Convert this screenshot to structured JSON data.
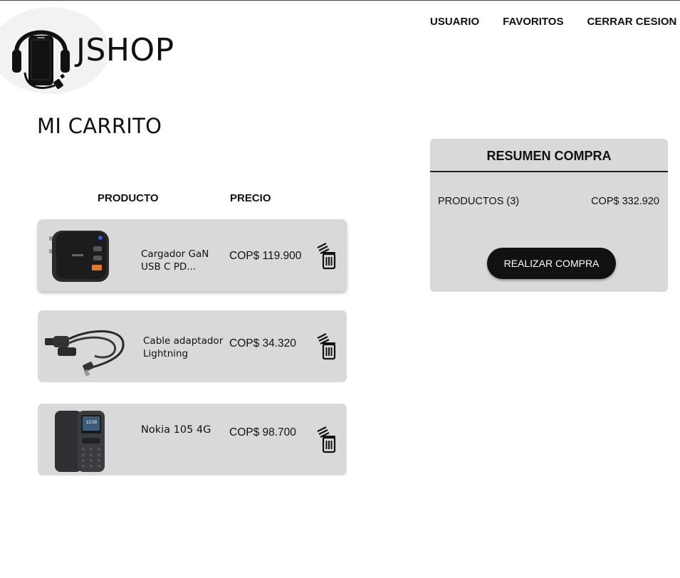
{
  "brand": {
    "name": "JSHOP",
    "logo_icon": "headphones-phone-logo"
  },
  "nav": [
    {
      "label": "USUARIO"
    },
    {
      "label": "FAVORITOS"
    },
    {
      "label": "CERRAR CESION"
    }
  ],
  "page": {
    "title": "MI CARRITO"
  },
  "cart": {
    "headers": {
      "product": "PRODUCTO",
      "price": "PRECIO"
    },
    "items": [
      {
        "name": "Cargador GaN USB C PD...",
        "price": "COP$ 119.900",
        "image": "charger-image",
        "action_icon": "trash-icon"
      },
      {
        "name": "Cable adaptador Lightning",
        "price": "COP$ 34.320",
        "image": "cable-adapter-image",
        "action_icon": "trash-icon"
      },
      {
        "name": "Nokia 105 4G",
        "price": "COP$ 98.700",
        "image": "nokia-phone-image",
        "action_icon": "trash-icon"
      }
    ]
  },
  "summary": {
    "title": "RESUMEN COMPRA",
    "products_label": "PRODUCTOS (3)",
    "total": "COP$ 332.920",
    "buy_button": "REALIZAR COMPRA"
  },
  "colors": {
    "card_bg": "#d9d9d9",
    "button_bg": "#111111",
    "button_text": "#ffffff"
  }
}
